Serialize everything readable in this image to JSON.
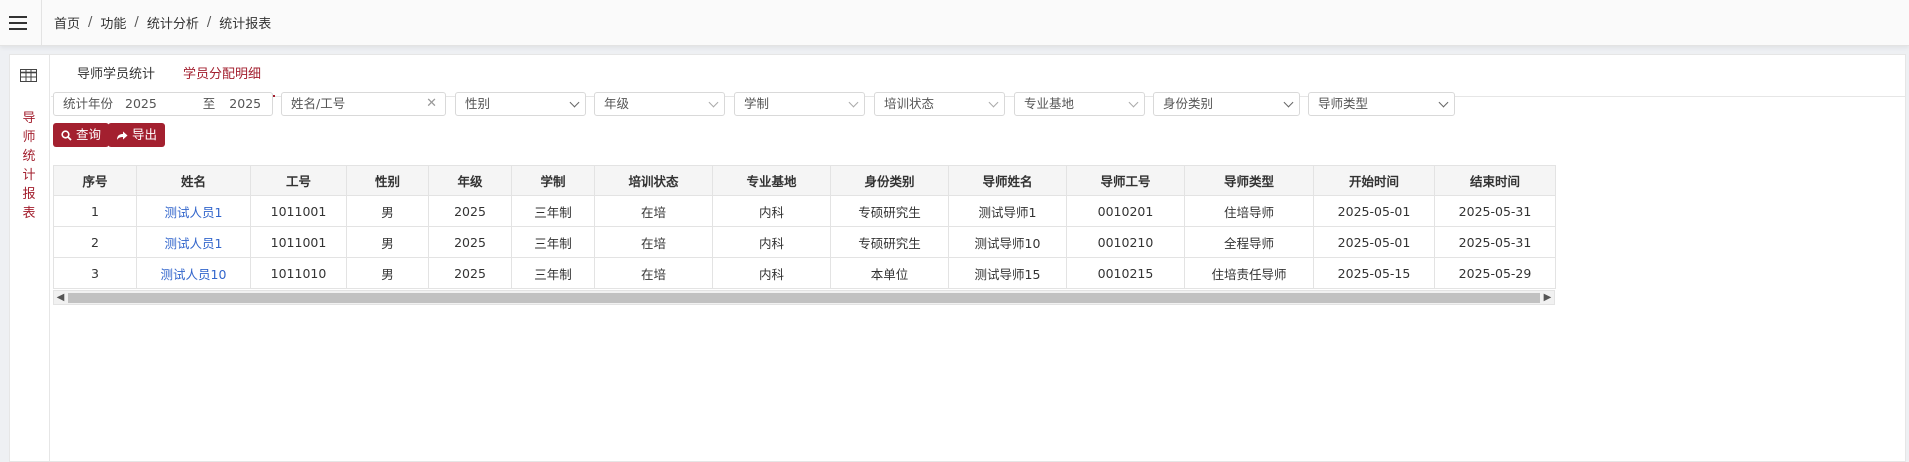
{
  "breadcrumb": [
    "首页",
    "功能",
    "统计分析",
    "统计报表"
  ],
  "sidebar": {
    "vertical_title": [
      "导",
      "师",
      "统",
      "计",
      "报",
      "表"
    ]
  },
  "tabs": [
    {
      "label": "导师学员统计",
      "active": false
    },
    {
      "label": "学员分配明细",
      "active": true
    }
  ],
  "filters": {
    "year_label": "统计年份",
    "year_from": "2025",
    "year_to_label": "至",
    "year_to": "2025",
    "name_placeholder": "姓名/工号",
    "gender": "性别",
    "grade": "年级",
    "system": "学制",
    "training_status": "培训状态",
    "base": "专业基地",
    "identity": "身份类别",
    "mentor_type": "导师类型"
  },
  "buttons": {
    "query": "查询",
    "export": "导出"
  },
  "table": {
    "headers": [
      "序号",
      "姓名",
      "工号",
      "性别",
      "年级",
      "学制",
      "培训状态",
      "专业基地",
      "身份类别",
      "导师姓名",
      "导师工号",
      "导师类型",
      "开始时间",
      "结束时间"
    ],
    "rows": [
      [
        "1",
        "测试人员1",
        "1011001",
        "男",
        "2025",
        "三年制",
        "在培",
        "内科",
        "专硕研究生",
        "测试导师1",
        "0010201",
        "住培导师",
        "2025-05-01",
        "2025-05-31"
      ],
      [
        "2",
        "测试人员1",
        "1011001",
        "男",
        "2025",
        "三年制",
        "在培",
        "内科",
        "专硕研究生",
        "测试导师10",
        "0010210",
        "全程导师",
        "2025-05-01",
        "2025-05-31"
      ],
      [
        "3",
        "测试人员10",
        "1011010",
        "男",
        "2025",
        "三年制",
        "在培",
        "内科",
        "本单位",
        "测试导师15",
        "0010215",
        "住培责任导师",
        "2025-05-15",
        "2025-05-29"
      ]
    ]
  },
  "colors": {
    "accent": "#a3202f",
    "link": "#3366cc"
  }
}
